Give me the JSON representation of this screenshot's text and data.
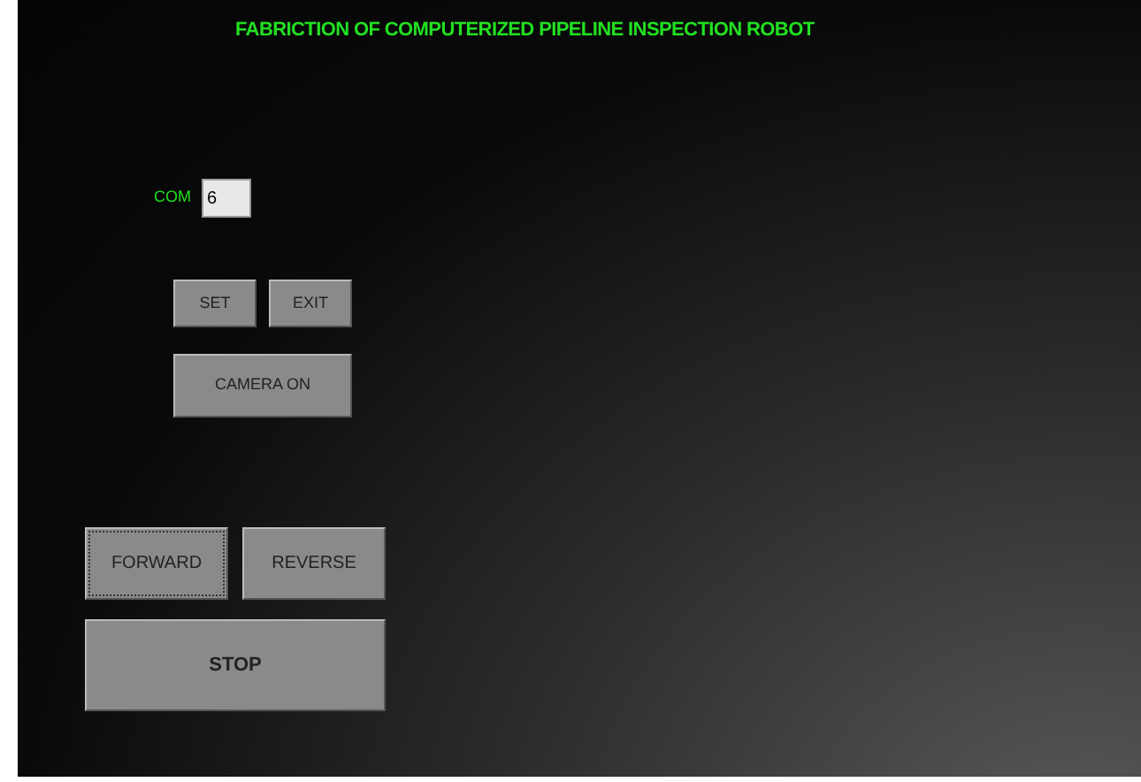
{
  "window": {
    "title": "FABRICTION OF COMPUTERIZED PIPELINE INSPECTION ROBOT"
  },
  "com_port": {
    "label": "COM",
    "value": "6"
  },
  "setup_buttons": [
    {
      "label": "SET",
      "focused": false
    },
    {
      "label": "EXIT",
      "focused": false
    }
  ],
  "camera_button": {
    "label": "CAMERA ON",
    "focused": false
  },
  "drive_buttons": [
    {
      "label": "FORWARD",
      "focused": true
    },
    {
      "label": "REVERSE",
      "focused": false
    }
  ],
  "stop_button": {
    "label": "STOP",
    "focused": false
  }
}
